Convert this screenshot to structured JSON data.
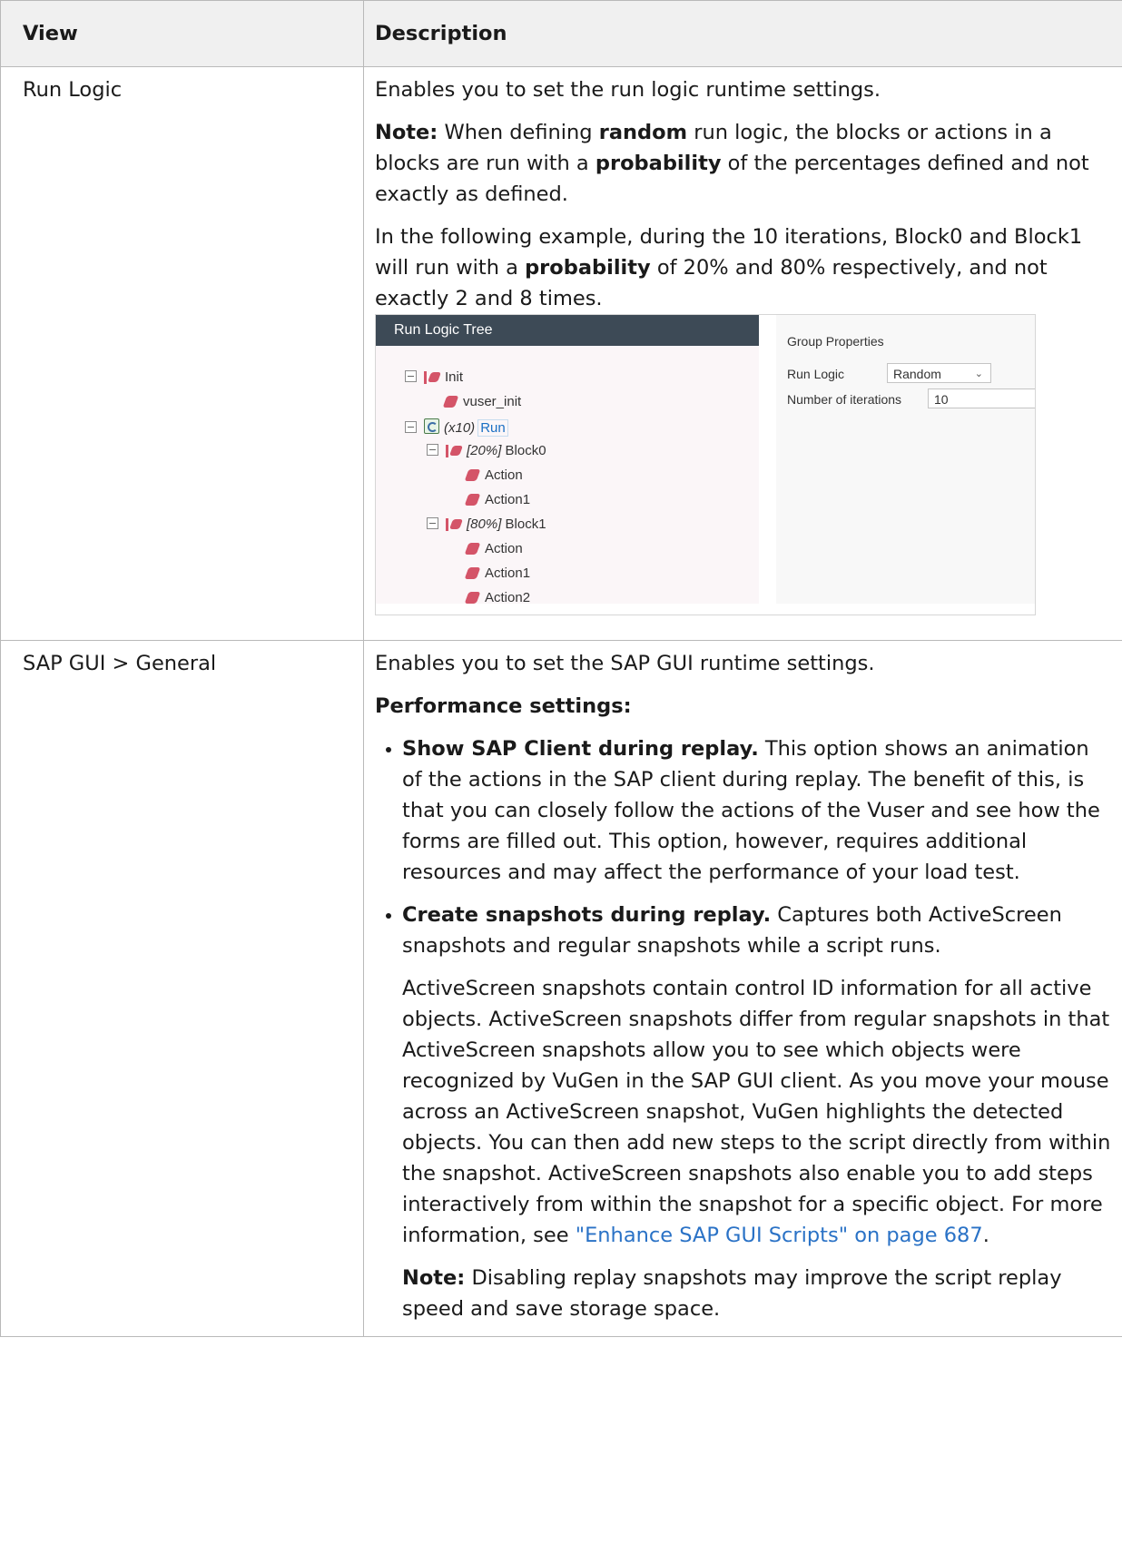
{
  "table": {
    "header": {
      "view": "View",
      "description": "Description"
    },
    "run_logic": {
      "view": "Run Logic",
      "intro": "Enables you to set the run logic runtime settings.",
      "note_label": "Note:",
      "note_part1": " When defining ",
      "note_bold1": "random",
      "note_part2": " run logic, the blocks or actions in a blocks are run with a ",
      "note_bold2": "probability",
      "note_part3": " of the percentages defined and not exactly as defined.",
      "example_part1": "In the following example, during the 10 iterations, Block0 and Block1 will run with a ",
      "example_bold": "probability",
      "example_part2": " of 20% and 80% respectively, and not exactly 2 and 8 times."
    },
    "sap_gui": {
      "view": "SAP GUI > General",
      "intro": "Enables you to set the SAP GUI runtime settings.",
      "perf_heading": "Performance settings:",
      "bullet1_title": "Show SAP Client during replay.",
      "bullet1_text": " This option shows an animation of the actions in the SAP client during replay. The benefit of this, is that you can closely follow the actions of the Vuser and see how the forms are filled out. This option, however, requires additional resources and may affect the performance of your load test.",
      "bullet2_title": "Create snapshots during replay.",
      "bullet2_text": " Captures both ActiveScreen snapshots and regular snapshots while a script runs.",
      "bullet2_para": "ActiveScreen snapshots contain control ID information for all active objects. ActiveScreen snapshots differ from regular snapshots in that ActiveScreen snapshots allow you to see which objects were recognized by VuGen in the SAP GUI client. As you move your mouse across an ActiveScreen snapshot, VuGen highlights the detected objects. You can then add new steps to the script directly from within the snapshot. ActiveScreen snapshots also enable you to add steps interactively from within the snapshot for a specific object. For more information, see ",
      "bullet2_link": "\"Enhance SAP GUI Scripts\" on page 687",
      "bullet2_end": ".",
      "note_label": "Note:",
      "note_text": " Disabling replay snapshots may improve the script replay speed and save storage space."
    }
  },
  "screenshot": {
    "tree_title": "Run Logic Tree",
    "nodes": {
      "init": "Init",
      "vuser_init": "vuser_init",
      "run_prefix": "(x10)",
      "run": "Run",
      "block0_prefix": "[20%]",
      "block0": "Block0",
      "b0_action": "Action",
      "b0_action1": "Action1",
      "block1_prefix": "[80%]",
      "block1": "Block1",
      "b1_action": "Action",
      "b1_action1": "Action1",
      "b1_action2": "Action2"
    },
    "props": {
      "title": "Group Properties",
      "run_logic_label": "Run Logic",
      "run_logic_value": "Random",
      "iterations_label": "Number of iterations",
      "iterations_value": "10"
    },
    "colors": {
      "header_bg": "#3d4a56",
      "tree_bg": "#fbf6f8",
      "action_icon": "#d45468",
      "link": "#1a6fc4"
    }
  }
}
